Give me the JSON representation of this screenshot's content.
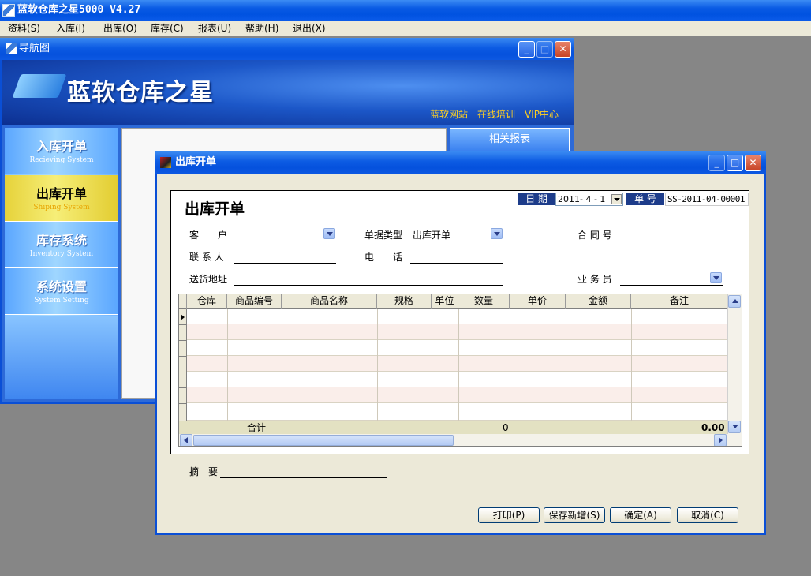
{
  "app": {
    "title": "蓝软仓库之星5000 V4.27"
  },
  "menu": [
    {
      "label": "资料(S)"
    },
    {
      "label": "入库(I)"
    },
    {
      "label": "出库(O)"
    },
    {
      "label": "库存(C)"
    },
    {
      "label": "报表(U)"
    },
    {
      "label": "帮助(H)"
    },
    {
      "label": "退出(X)"
    }
  ],
  "nav_window": {
    "title": "导航图",
    "banner_title": "蓝软仓库之星",
    "links": [
      "蓝软网站",
      "在线培训",
      "VIP中心"
    ],
    "report_button": "相关报表",
    "items": [
      {
        "cn": "入库开单",
        "en": "Recieving System"
      },
      {
        "cn": "出库开单",
        "en": "Shiping System"
      },
      {
        "cn": "库存系统",
        "en": "Inventory System"
      },
      {
        "cn": "系统设置",
        "en": "System Setting"
      }
    ]
  },
  "dialog": {
    "title": "出库开单",
    "form_title": "出库开单",
    "date_label": "日 期",
    "date_value": "2011- 4 - 1",
    "docno_label": "单 号",
    "docno_value": "SS-2011-04-00001",
    "labels": {
      "customer": "客　　户",
      "doc_type": "单据类型",
      "contract_no": "合 同 号",
      "contact": "联 系 人",
      "phone": "电　　话",
      "address": "送货地址",
      "salesman": "业 务 员",
      "summary": "摘　要"
    },
    "values": {
      "doc_type": "出库开单"
    },
    "grid": {
      "columns": [
        "仓库",
        "商品编号",
        "商品名称",
        "规格",
        "单位",
        "数量",
        "单价",
        "金额",
        "备注"
      ],
      "total_label": "合计",
      "total_qty": "0",
      "total_amount": "0.00"
    },
    "buttons": {
      "print": "打印(P)",
      "save_new": "保存新增(S)",
      "ok": "确定(A)",
      "cancel": "取消(C)"
    }
  }
}
